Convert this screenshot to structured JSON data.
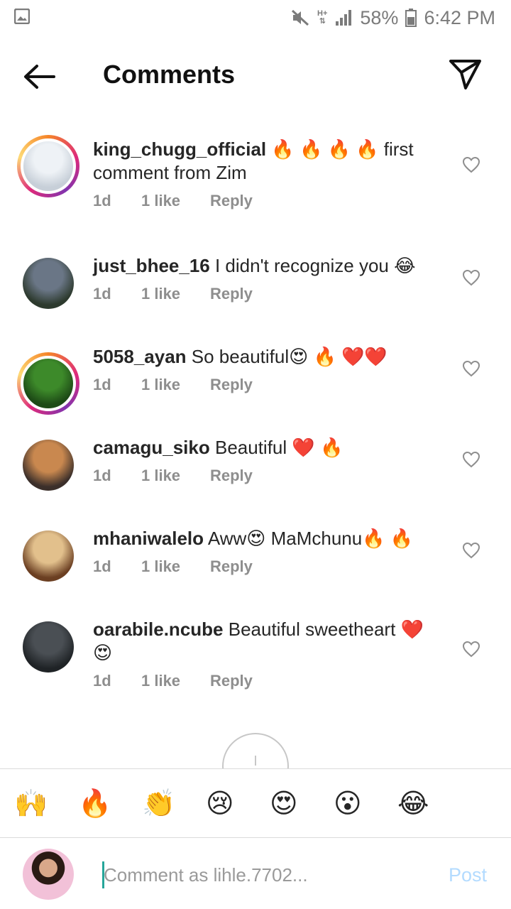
{
  "status_bar": {
    "network": "H+",
    "battery": "58%",
    "time": "6:42 PM"
  },
  "header": {
    "title": "Comments"
  },
  "comments": [
    {
      "username": "king_chugg_official",
      "text": " 🔥 🔥 🔥 🔥 first comment from Zim",
      "time": "1d",
      "likes": "1 like",
      "reply": "Reply",
      "story_ring": true,
      "avatar_colors": [
        "#eef2f6",
        "#c7cfd8"
      ]
    },
    {
      "username": "just_bhee_16",
      "text": " I didn't recognize you 😂",
      "time": "1d",
      "likes": "1 like",
      "reply": "Reply",
      "story_ring": false,
      "avatar_colors": [
        "#6a7686",
        "#2d3a2e"
      ]
    },
    {
      "username": "5058_ayan",
      "text": " So beautiful😍 🔥 ❤️❤️",
      "time": "1d",
      "likes": "1 like",
      "reply": "Reply",
      "story_ring": true,
      "avatar_colors": [
        "#3d8a2a",
        "#1d4a16"
      ]
    },
    {
      "username": "camagu_siko",
      "text": " Beautiful ❤️ 🔥",
      "time": "1d",
      "likes": "1 like",
      "reply": "Reply",
      "story_ring": false,
      "avatar_colors": [
        "#c9884f",
        "#3b2f2a"
      ]
    },
    {
      "username": "mhaniwalelo",
      "text": " Aww😍 MaMchunu🔥 🔥",
      "time": "1d",
      "likes": "1 like",
      "reply": "Reply",
      "story_ring": false,
      "avatar_colors": [
        "#e2c08c",
        "#6b3f22"
      ]
    },
    {
      "username": "oarabile.ncube",
      "text": " Beautiful sweetheart ❤️ 😍",
      "time": "1d",
      "likes": "1 like",
      "reply": "Reply",
      "story_ring": false,
      "avatar_colors": [
        "#4a4f54",
        "#1f2326"
      ]
    }
  ],
  "emoji_bar": [
    "🙌",
    "🔥",
    "👏",
    "😢",
    "😍",
    "😮",
    "😂"
  ],
  "composer": {
    "placeholder": "Comment as lihle.7702...",
    "post_label": "Post"
  },
  "colors": {
    "post_disabled": "#b3dbff",
    "meta_text": "#8e8e8e",
    "caret": "#26a69a"
  }
}
